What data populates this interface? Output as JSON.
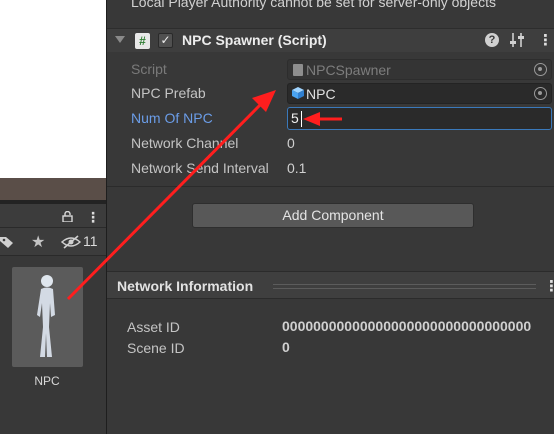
{
  "inspector": {
    "warning": "Local Player Authority cannot be set for server-only objects",
    "component": {
      "title": "NPC Spawner (Script)",
      "script_icon": "#",
      "enabled_check": "✓",
      "help_icon": "?",
      "menu_icon": "⋮"
    },
    "fields": {
      "script_label": "Script",
      "script_value": "NPCSpawner",
      "prefab_label": "NPC Prefab",
      "prefab_value": "NPC",
      "num_label": "Num Of NPC",
      "num_value": "5",
      "channel_label": "Network Channel",
      "channel_value": "0",
      "interval_label": "Network Send Interval",
      "interval_value": "0.1"
    },
    "add_component_label": "Add Component",
    "network_info": {
      "title": "Network Information",
      "menu_icon": "⋮",
      "asset_id_label": "Asset ID",
      "asset_id_value": "00000000000000000000000000000000",
      "scene_id_label": "Scene ID",
      "scene_id_value": "0"
    }
  },
  "project": {
    "hidden_count": "11",
    "menu_icon": "⋮",
    "star_icon": "★",
    "asset_label": "NPC"
  },
  "colors": {
    "background": "#383838",
    "focus_outline": "#3a79bb",
    "focused_label": "#6b9de8",
    "annotation_arrow": "#ff1e1e"
  },
  "icons": [
    "foldout-icon",
    "script-icon",
    "help-icon",
    "preset-icon",
    "kebab-menu-icon",
    "object-picker-icon",
    "prefab-cube-icon",
    "lock-icon",
    "tag-icon",
    "star-icon",
    "eye-off-icon"
  ]
}
